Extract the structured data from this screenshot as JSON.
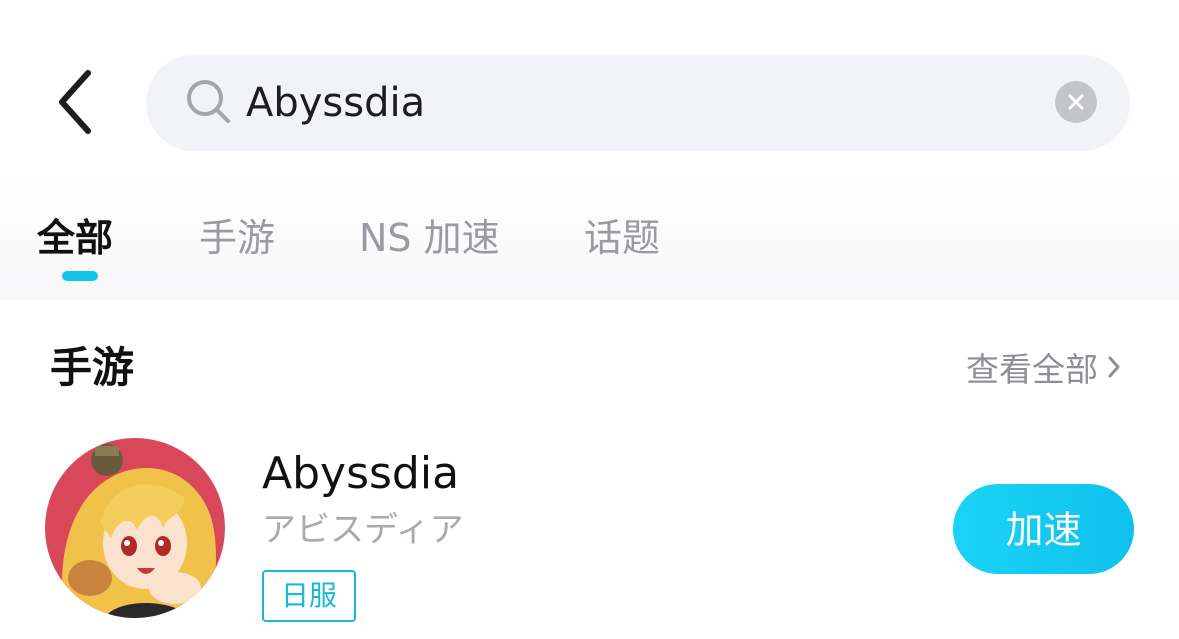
{
  "search": {
    "query": "Abyssdia",
    "placeholder": ""
  },
  "tabs": [
    {
      "label": "全部",
      "active": true
    },
    {
      "label": "手游",
      "active": false
    },
    {
      "label": "NS 加速",
      "active": false
    },
    {
      "label": "话题",
      "active": false
    }
  ],
  "section": {
    "title": "手游",
    "view_all": "查看全部"
  },
  "game": {
    "name": "Abyssdia",
    "subtitle": "アビスディア",
    "region": "日服",
    "action": "加速"
  },
  "icons": {
    "back": "back-chevron-icon",
    "search": "search-icon",
    "clear": "clear-icon",
    "view_all": "chevron-right-icon"
  },
  "colors": {
    "accent": "#12c6e8",
    "search_bg": "#f2f3f7",
    "text_primary": "#111111",
    "text_secondary": "#9a9ba0"
  }
}
